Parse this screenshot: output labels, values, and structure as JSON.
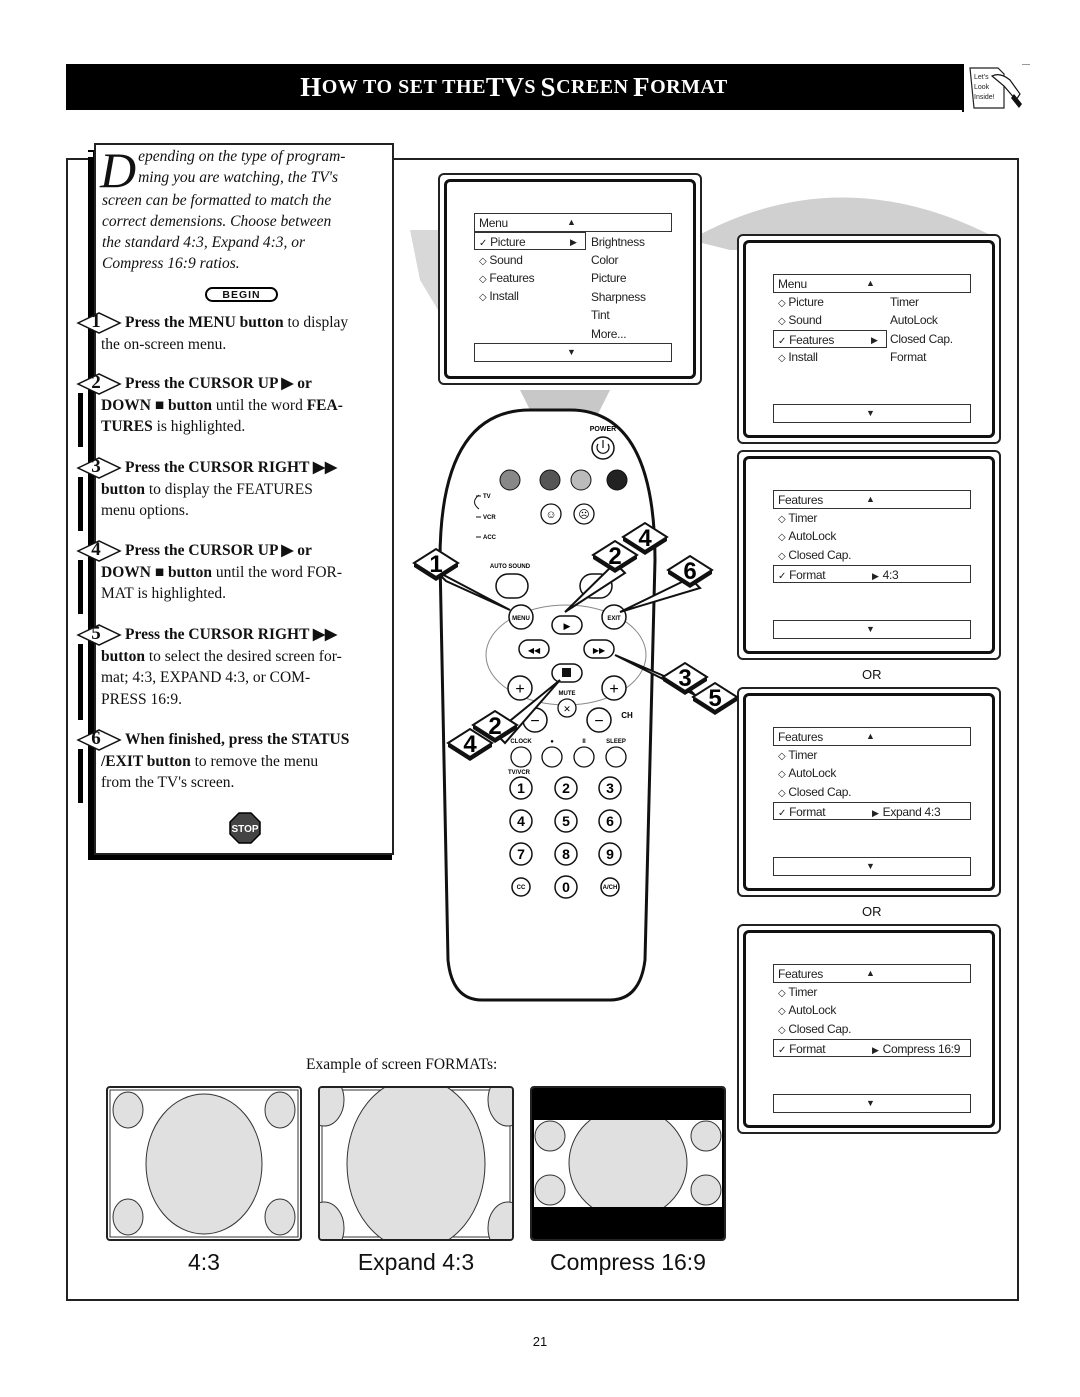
{
  "header": {
    "title_parts": [
      {
        "text": "H",
        "size": "big"
      },
      {
        "text": "OW TO SET THE ",
        "size": "small"
      },
      {
        "text": "TV",
        "size": "big"
      },
      {
        "text": "S ",
        "size": "small"
      },
      {
        "text": "S",
        "size": "big"
      },
      {
        "text": "CREEN ",
        "size": "small"
      },
      {
        "text": "F",
        "size": "big"
      },
      {
        "text": "ORMAT",
        "size": "small"
      }
    ],
    "title_full": "How to set the TVs Screen Format",
    "badge": {
      "icon": "lets-look-inside-icon",
      "lines": [
        "Let's",
        "Look",
        "Inside!"
      ]
    }
  },
  "intro": {
    "dropcap": "D",
    "text": "epending on the type of programming you are watching, the TV's screen can be formatted to match the correct demensions. Choose between the standard 4:3, Expand 4:3, or Compress 16:9 ratios.",
    "lines": [
      "epending on the type of program-",
      "ming you are watching, the TV's",
      "screen can be formatted to match the",
      "correct demensions. Choose between",
      "the standard 4:3, Expand 4:3, or",
      "Compress 16:9 ratios."
    ],
    "begin_label": "BEGIN"
  },
  "steps": [
    {
      "number": "1",
      "bold": "Press the MENU button",
      "text": " to display",
      "rest": "the on-screen menu."
    },
    {
      "number": "2",
      "bold": "Press the CURSOR UP ▶ or",
      "line2_bold": "DOWN ■ button",
      "line2": " until the word ",
      "line2_bold2": "FEA-",
      "line3_bold": "TURES",
      "line3": " is highlighted."
    },
    {
      "number": "3",
      "bold": "Press the CURSOR RIGHT ▶▶",
      "line2_bold": "button",
      "line2": " to display the FEATURES",
      "line3": "menu options."
    },
    {
      "number": "4",
      "bold": "Press the CURSOR UP ▶ or",
      "line2_bold": "DOWN ■ button",
      "line2": " until the word FOR-",
      "line3": "MAT is highlighted."
    },
    {
      "number": "5",
      "bold": "Press the CURSOR RIGHT ▶▶",
      "line2_bold": "button",
      "line2": " to select the desired screen for-",
      "line3": "mat; 4:3, EXPAND 4:3, or COM-",
      "line4": "PRESS 16:9."
    },
    {
      "number": "6",
      "bold": "When finished, press the STATUS",
      "line2_bold": "/EXIT button",
      "line2": " to remove the menu",
      "line3": "from the TV's screen."
    }
  ],
  "stop_label": "STOP",
  "screens": {
    "main_menu": {
      "title": "Menu",
      "items": [
        {
          "symbol": "✓",
          "label": "Picture",
          "selected": true
        },
        {
          "symbol": "◇",
          "label": "Sound",
          "selected": false
        },
        {
          "symbol": "◇",
          "label": "Features",
          "selected": false
        },
        {
          "symbol": "◇",
          "label": "Install",
          "selected": false
        }
      ],
      "submenu": [
        "Brightness",
        "Color",
        "Picture",
        "Sharpness",
        "Tint",
        "More..."
      ]
    },
    "features_menu": {
      "title": "Menu",
      "items": [
        {
          "symbol": "◇",
          "label": "Picture",
          "selected": false
        },
        {
          "symbol": "◇",
          "label": "Sound",
          "selected": false
        },
        {
          "symbol": "✓",
          "label": "Features",
          "selected": true
        },
        {
          "symbol": "◇",
          "label": "Install",
          "selected": false
        }
      ],
      "submenu": [
        "Timer",
        "AutoLock",
        "Closed Cap.",
        "Format"
      ]
    },
    "format_screens": [
      {
        "title": "Features",
        "items": [
          "Timer",
          "AutoLock",
          "Closed Cap."
        ],
        "selected_label": "Format",
        "value": "4:3"
      },
      {
        "title": "Features",
        "items": [
          "Timer",
          "AutoLock",
          "Closed Cap."
        ],
        "selected_label": "Format",
        "value": "Expand 4:3"
      },
      {
        "title": "Features",
        "items": [
          "Timer",
          "AutoLock",
          "Closed Cap."
        ],
        "selected_label": "Format",
        "value": "Compress 16:9"
      }
    ],
    "or_label": "OR"
  },
  "remote": {
    "power_label": "POWER",
    "mode_labels": [
      "TV",
      "VCR",
      "ACC"
    ],
    "auto_sound_label": "AUTO SOUND",
    "menu_label": "MENU",
    "exit_label": "EXIT",
    "mute_label": "MUTE",
    "ch_label": "CH",
    "bottom_row": [
      "CLOCK",
      "●",
      "II",
      "SLEEP"
    ],
    "tvvcr_label": "TV/VCR",
    "digits": [
      "1",
      "2",
      "3",
      "4",
      "5",
      "6",
      "7",
      "8",
      "9",
      "CC",
      "0",
      "A/CH"
    ],
    "callouts": [
      "1",
      "2",
      "4",
      "6",
      "3",
      "5",
      "2",
      "4"
    ]
  },
  "examples": {
    "label": "Example of screen FORMATs:",
    "items": [
      {
        "caption": "4:3"
      },
      {
        "caption": "Expand 4:3"
      },
      {
        "caption": "Compress 16:9"
      }
    ]
  },
  "page_number": "21"
}
